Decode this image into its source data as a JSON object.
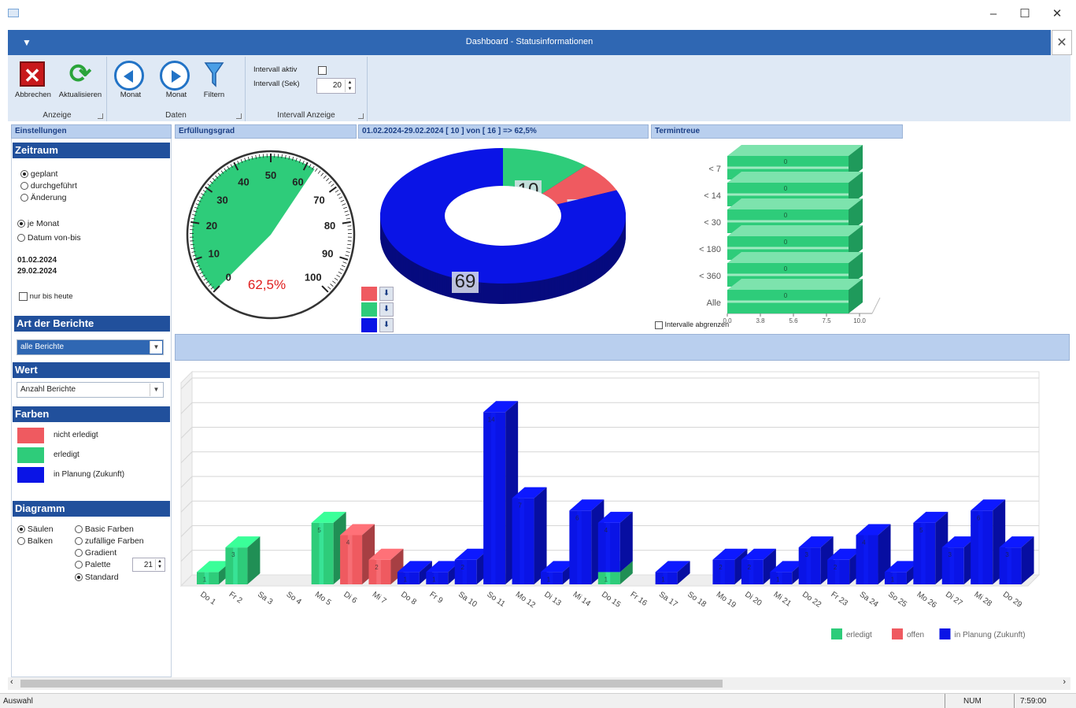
{
  "window": {
    "minimize": "–",
    "maximize": "☐",
    "close": "✕",
    "inner_close": "✕"
  },
  "header": {
    "title": "Dashboard - Statusinformationen",
    "menu_icon": "▼"
  },
  "ribbon": {
    "groups": {
      "anzeige": "Anzeige",
      "daten": "Daten",
      "intervall": "Intervall Anzeige"
    },
    "buttons": {
      "abbrechen": "Abbrechen",
      "aktualisieren": "Aktualisieren",
      "monat_prev": "Monat",
      "monat_next": "Monat",
      "filtern": "Filtern"
    },
    "intervall_aktiv_label": "Intervall aktiv",
    "intervall_sek_label": "Intervall (Sek)",
    "intervall_sek_value": "20"
  },
  "left": {
    "einstellungen": "Einstellungen",
    "zeitraum": "Zeitraum",
    "radio_geplant": "geplant",
    "radio_durchgefuehrt": "durchgeführt",
    "radio_aenderung": "Änderung",
    "radio_je_monat": "je Monat",
    "radio_datum": "Datum von-bis",
    "date_from": "01.02.2024",
    "date_to": "29.02.2024",
    "nur_bis_heute": "nur bis heute",
    "art_der_berichte": "Art der Berichte",
    "berichte_value": "alle Berichte",
    "wert": "Wert",
    "wert_value": "Anzahl Berichte",
    "farben": "Farben",
    "farben_items": [
      {
        "label": "nicht erledigt",
        "color": "#ef5a60"
      },
      {
        "label": "erledigt",
        "color": "#2ecc7a"
      },
      {
        "label": "in Planung (Zukunft)",
        "color": "#0a14e6"
      }
    ],
    "diagramm": "Diagramm",
    "radio_saeulen": "Säulen",
    "radio_balken": "Balken",
    "radio_basic": "Basic Farben",
    "radio_zufall": "zufällige Farben",
    "radio_gradient": "Gradient",
    "radio_palette": "Palette",
    "radio_standard": "Standard",
    "palette_value": "21"
  },
  "panels": {
    "erfuellung": "Erfüllungsgrad",
    "period": "01.02.2024-29.02.2024       [    10 ] von [ 16 ]     => 62,5%",
    "termintreue": "Termintreue"
  },
  "gauge": {
    "value_label": "62,5%",
    "value": 62.5,
    "ticks": [
      "0",
      "10",
      "20",
      "30",
      "40",
      "50",
      "60",
      "70",
      "80",
      "90",
      "100"
    ]
  },
  "donut": {
    "values": [
      {
        "label": "10",
        "value": 10,
        "color": "#2ecc7a"
      },
      {
        "label": "6",
        "value": 6,
        "color": "#ef5a60"
      },
      {
        "label": "69",
        "value": 69,
        "color": "#0a14e6"
      }
    ],
    "arrow": "⬇"
  },
  "termintreue": {
    "rows": [
      {
        "label": "< 7",
        "value": "0"
      },
      {
        "label": "< 14",
        "value": "0"
      },
      {
        "label": "< 30",
        "value": "0"
      },
      {
        "label": "< 180",
        "value": "0"
      },
      {
        "label": "< 360",
        "value": "0"
      },
      {
        "label": "Alle",
        "value": "0"
      }
    ],
    "x_ticks": [
      "0.0",
      "3.8",
      "5.6",
      "7.5",
      "10.0"
    ],
    "zero_tick": "0.0",
    "checkbox_label": "Intervalle abgrenzen"
  },
  "chart_data": {
    "type": "bar",
    "categories": [
      "Do 1",
      "Fr 2",
      "Sa 3",
      "So 4",
      "Mo 5",
      "Di 6",
      "Mi 7",
      "Do 8",
      "Fr 9",
      "Sa 10",
      "So 11",
      "Mo 12",
      "Di 13",
      "Mi 14",
      "Do 15",
      "Fr 16",
      "Sa 17",
      "So 18",
      "Mo 19",
      "Di 20",
      "Mi 21",
      "Do 22",
      "Fr 23",
      "Sa 24",
      "So 25",
      "Mo 26",
      "Di 27",
      "Mi 28",
      "Do 29"
    ],
    "series": [
      {
        "name": "erledigt",
        "color": "#2ecc7a",
        "values": [
          1,
          3,
          0,
          0,
          5,
          0,
          0,
          0,
          0,
          0,
          0,
          0,
          0,
          0,
          1,
          0,
          0,
          0,
          0,
          0,
          0,
          0,
          0,
          0,
          0,
          0,
          0,
          0,
          0
        ]
      },
      {
        "name": "offen",
        "color": "#ef5a60",
        "values": [
          0,
          0,
          0,
          0,
          0,
          4,
          2,
          0,
          0,
          0,
          0,
          0,
          0,
          0,
          0,
          0,
          0,
          0,
          0,
          0,
          0,
          0,
          0,
          0,
          0,
          0,
          0,
          0,
          0
        ]
      },
      {
        "name": "in Planung (Zukunft)",
        "color": "#0a14e6",
        "values": [
          0,
          0,
          0,
          0,
          0,
          0,
          0,
          1,
          1,
          2,
          14,
          7,
          1,
          6,
          4,
          0,
          1,
          0,
          2,
          2,
          1,
          3,
          2,
          4,
          1,
          5,
          3,
          6,
          3
        ]
      }
    ],
    "ylim": [
      0,
      16
    ]
  },
  "status": {
    "left": "Auswahl",
    "num": "NUM",
    "time": "7:59:00"
  },
  "scroll": {
    "left": "‹",
    "right": "›"
  }
}
